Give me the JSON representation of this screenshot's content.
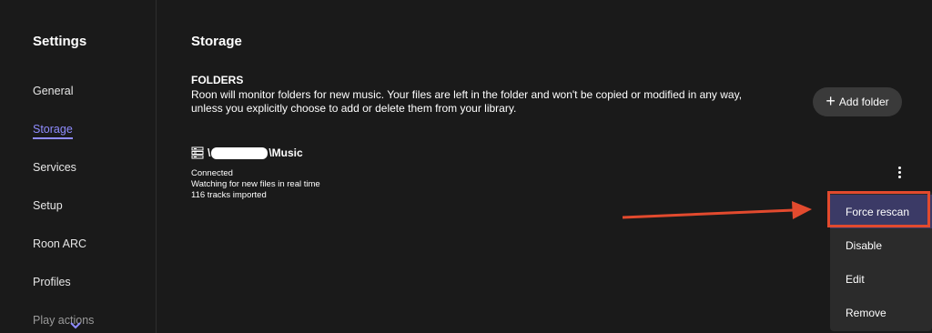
{
  "sidebar": {
    "title": "Settings",
    "items": [
      {
        "label": "General"
      },
      {
        "label": "Storage"
      },
      {
        "label": "Services"
      },
      {
        "label": "Setup"
      },
      {
        "label": "Roon ARC"
      },
      {
        "label": "Profiles"
      },
      {
        "label": "Play actions"
      }
    ],
    "active": "Storage"
  },
  "main": {
    "title": "Storage",
    "section": {
      "heading": "FOLDERS",
      "description": "Roon will monitor folders for new music. Your files are left in the folder and won't be copied or modified in any way, unless you explicitly choose to add or delete them from your library.",
      "add_button": "Add folder"
    },
    "folder": {
      "name_prefix": "\\",
      "name_suffix": "\\Music",
      "status_lines": [
        "Connected",
        "Watching for new files in real time",
        "116 tracks imported"
      ]
    },
    "context_menu": {
      "items": [
        {
          "label": "Force rescan"
        },
        {
          "label": "Disable"
        },
        {
          "label": "Edit"
        },
        {
          "label": "Remove"
        }
      ],
      "highlighted": "Force rescan"
    }
  },
  "colors": {
    "background": "#1a1a1a",
    "accent": "#8f8cff",
    "annotation": "#e24a2e",
    "menu_highlight": "#3b3a66"
  },
  "icons": [
    "folder-icon",
    "plus-icon",
    "more-vertical-icon",
    "chevron-down-icon",
    "arrow-annotation-icon"
  ]
}
